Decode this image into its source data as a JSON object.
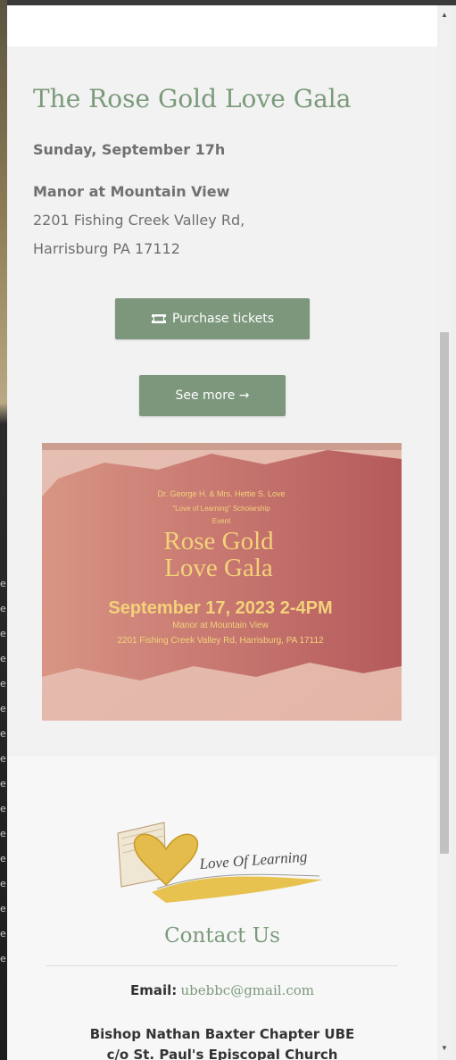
{
  "event": {
    "title": "The Rose Gold Love Gala",
    "date": "Sunday, September 17h",
    "venue": "Manor at Mountain View",
    "address_line1": "2201 Fishing Creek Valley Rd,",
    "address_line2": "Harrisburg PA 17112",
    "tickets_button": "Purchase tickets",
    "see_more_button": "See more →"
  },
  "flyer": {
    "hosts": "Dr. George H. & Mrs. Hettie S. Love",
    "scholarship": "\"Love of Learning\" Scholarship",
    "event_word": "Event",
    "headline_1": "Rose Gold",
    "headline_2": "Love Gala",
    "date_time": "September 17, 2023 2-4PM",
    "venue": "Manor at Mountain View",
    "address": "2201 Fishing Creek Valley Rd, Harrisburg, PA 17112"
  },
  "footer": {
    "logo_text": "Love Of Learning",
    "contact_title": "Contact Us",
    "email_label": "Email:",
    "email": "ubebbc@gmail.com",
    "org_name": "Bishop Nathan Baxter Chapter UBE",
    "org_sub": "c/o St. Paul's Episcopal Church"
  },
  "background_edge_letters": [
    "e",
    "e",
    "e",
    "e",
    "e",
    "e",
    "e",
    "e",
    "e",
    "e",
    "e",
    "e",
    "e",
    "e",
    "e",
    "e"
  ],
  "icons": {
    "tickets": "ticket-icon",
    "scroll_up": "scroll-up-arrow-icon",
    "scroll_down": "scroll-down-arrow-icon"
  },
  "colors": {
    "accent": "#7c977c",
    "title": "#7b9a7b",
    "flyer_text": "#f3d27a",
    "flyer_bg": "#c77a72"
  }
}
